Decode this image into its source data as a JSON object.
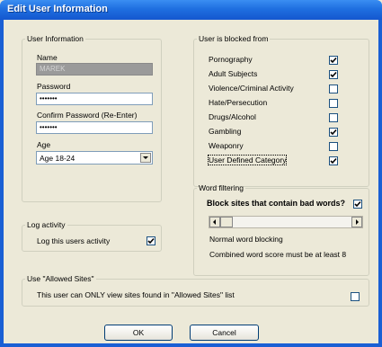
{
  "window": {
    "title": "Edit User Information"
  },
  "user_info": {
    "legend": "User Information",
    "name_label": "Name",
    "name_value": "MAREK",
    "password_label": "Password",
    "password_value": "•••••••",
    "confirm_label": "Confirm Password (Re-Enter)",
    "confirm_value": "•••••••",
    "age_label": "Age",
    "age_value": "Age 18-24"
  },
  "blocked": {
    "legend": "User is blocked from",
    "items": [
      {
        "label": "Pornography",
        "checked": true
      },
      {
        "label": "Adult Subjects",
        "checked": true
      },
      {
        "label": "Violence/Criminal Activity",
        "checked": false
      },
      {
        "label": "Hate/Persecution",
        "checked": false
      },
      {
        "label": "Drugs/Alcohol",
        "checked": false
      },
      {
        "label": "Gambling",
        "checked": true
      },
      {
        "label": "Weaponry",
        "checked": false
      },
      {
        "label": "User Defined Category",
        "checked": true
      }
    ]
  },
  "word_filter": {
    "legend": "Word filtering",
    "block_label": "Block sites that contain bad words?",
    "block_checked": true,
    "slider_position": 0,
    "level_text": "Normal word blocking",
    "score_text": "Combined word score must be at least 8"
  },
  "log": {
    "legend": "Log activity",
    "label": "Log this users activity",
    "checked": true
  },
  "allowed": {
    "legend": "Use \"Allowed Sites\"",
    "label": "This user can ONLY view sites found in \"Allowed Sites\"  list",
    "checked": false
  },
  "buttons": {
    "ok": "OK",
    "cancel": "Cancel"
  }
}
